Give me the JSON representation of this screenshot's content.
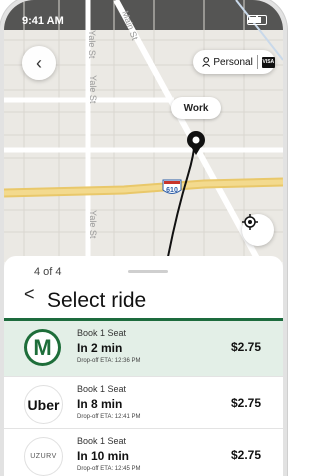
{
  "status_bar": {
    "time": "9:41 AM"
  },
  "map": {
    "street_labels": [
      "Main St",
      "Yale St",
      "Yale St",
      "Yale St"
    ],
    "highway_shield": "610",
    "destination_label": "Work",
    "profile_chip": {
      "label": "Personal",
      "card_brand": "VISA"
    },
    "icons": {
      "back": "back-icon",
      "locate": "locate-icon",
      "person": "person-icon",
      "destination": "destination-pin-icon"
    }
  },
  "sheet": {
    "step": "4 of 4",
    "title": "Select ride",
    "back_glyph": "<",
    "accent_color": "#1d6b3d"
  },
  "rides": [
    {
      "provider": "metro",
      "logo_text": "M",
      "seat": "Book 1 Seat",
      "time": "In 2 min",
      "eta": "Drop-off ETA: 12:36 PM",
      "price": "$2.75",
      "selected": true
    },
    {
      "provider": "uber",
      "logo_text": "Uber",
      "seat": "Book 1 Seat",
      "time": "In 8 min",
      "eta": "Drop-off ETA: 12:41 PM",
      "price": "$2.75",
      "selected": false
    },
    {
      "provider": "uzurv",
      "logo_text": "UZURV",
      "seat": "Book 1 Seat",
      "time": "In 10 min",
      "eta": "Drop-off ETA: 12:45 PM",
      "price": "$2.75",
      "selected": false
    }
  ]
}
